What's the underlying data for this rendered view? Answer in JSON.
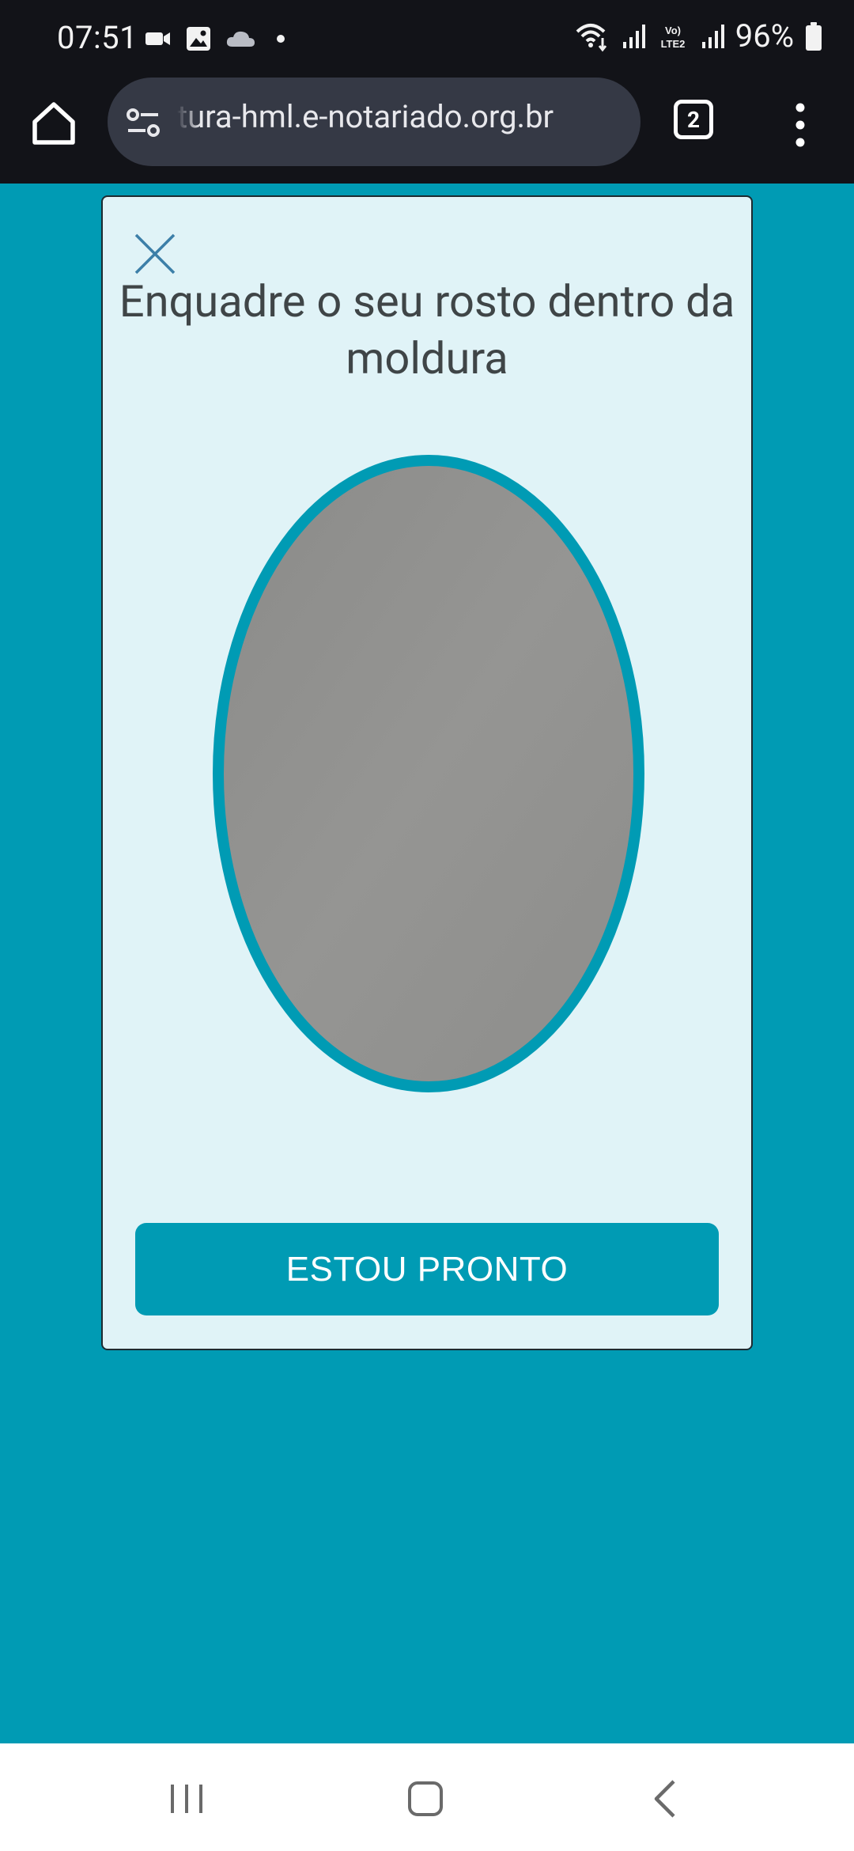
{
  "status_bar": {
    "time": "07:51",
    "battery": "96%",
    "left_icons": [
      "video-call-icon",
      "gallery-icon",
      "cloud-icon",
      "dot-icon"
    ],
    "right_icons": [
      "wifi-icon",
      "signal-icon",
      "volte-icon",
      "signal-icon",
      "battery-icon"
    ]
  },
  "browser": {
    "url": "tura-hml.e-notariado.org.br",
    "tab_count": "2"
  },
  "modal": {
    "title": "Enquadre o seu rosto dentro da moldura",
    "button_label": "ESTOU PRONTO"
  },
  "colors": {
    "accent": "#009bb4",
    "card_background": "#e0f3f7",
    "title_text": "#3f4547",
    "camera_preview": "#8f8f8d"
  }
}
